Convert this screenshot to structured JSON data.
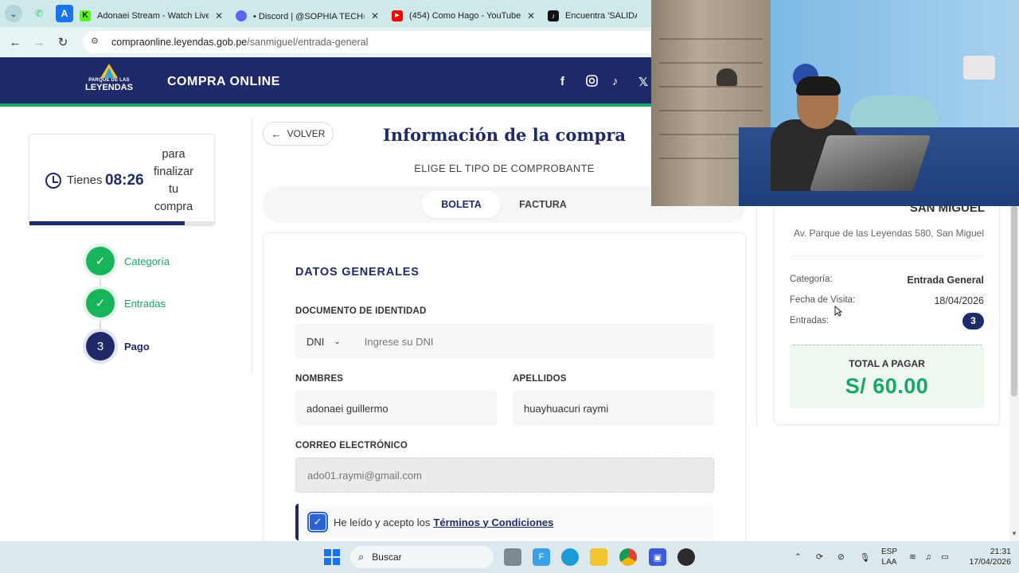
{
  "browser": {
    "tabs": [
      {
        "title": "Adonaei Stream - Watch Live o",
        "favicon_color": "#1b1b1b",
        "favicon_letter": "K"
      },
      {
        "title": "• Discord | @SOPHIA TECH💕❤",
        "favicon_color": "#5865f2",
        "favicon_letter": ""
      },
      {
        "title": "(454) Como Hago - YouTube",
        "favicon_color": "#ff0000",
        "favicon_letter": "▶"
      },
      {
        "title": "Encuentra 'SALIDA P",
        "favicon_color": "#111111",
        "favicon_letter": "♪"
      }
    ],
    "url_host": "compraonline.leyendas.gob.pe",
    "url_path": "/sanmiguel/entrada-general"
  },
  "header": {
    "logo_top": "PARQUE DE LAS",
    "logo_bottom": "LEYENDAS",
    "title": "COMPRA ONLINE",
    "social_icons": [
      "facebook-icon",
      "instagram-icon",
      "tiktok-icon",
      "x-icon"
    ]
  },
  "timer": {
    "prefix": "Tienes",
    "time": "08:26",
    "suffix": "para finalizar tu compra",
    "progress": 0.84
  },
  "steps": [
    {
      "label": "Categoría",
      "state": "done",
      "number": "✓"
    },
    {
      "label": "Entradas",
      "state": "done",
      "number": "✓"
    },
    {
      "label": "Pago",
      "state": "active",
      "number": "3"
    }
  ],
  "main": {
    "back_label": "VOLVER",
    "title": "Información de la compra",
    "subtitle": "ELIGE EL TIPO DE COMPROBANTE",
    "tabs": [
      {
        "label": "BOLETA",
        "active": true
      },
      {
        "label": "FACTURA",
        "active": false
      }
    ],
    "section_title": "DATOS GENERALES",
    "doc_label": "DOCUMENTO DE IDENTIDAD",
    "doc_type": "DNI",
    "doc_placeholder": "Ingrese su DNI",
    "names_label": "NOMBRES",
    "names_value": "adonaei guillermo",
    "surnames_label": "APELLIDOS",
    "surnames_value": "huayhuacuri raymi",
    "email_label": "CORREO ELECTRÓNICO",
    "email_value": "ado01.raymi@gmail.com",
    "terms_text": "He leído y acepto los",
    "terms_link": "Términos y Condiciones",
    "terms_checked": true
  },
  "summary": {
    "park_name": "SAN MIGUEL",
    "address": "Av. Parque de las Leyendas 580, San Miguel",
    "category_label": "Categoría:",
    "category_value": "Entrada General",
    "date_label": "Fecha de Visita:",
    "date_value": "18/04/2026",
    "tickets_label": "Entradas:",
    "tickets_value": "3",
    "total_label": "TOTAL A PAGAR",
    "total_value": "S/ 60.00"
  },
  "taskbar": {
    "search_label": "Buscar",
    "lang_top": "ESP",
    "lang_bottom": "LAA",
    "time": "21:31",
    "date": "17/04/2026"
  },
  "colors": {
    "brand_navy": "#1f2a6b",
    "brand_green": "#18a865"
  }
}
